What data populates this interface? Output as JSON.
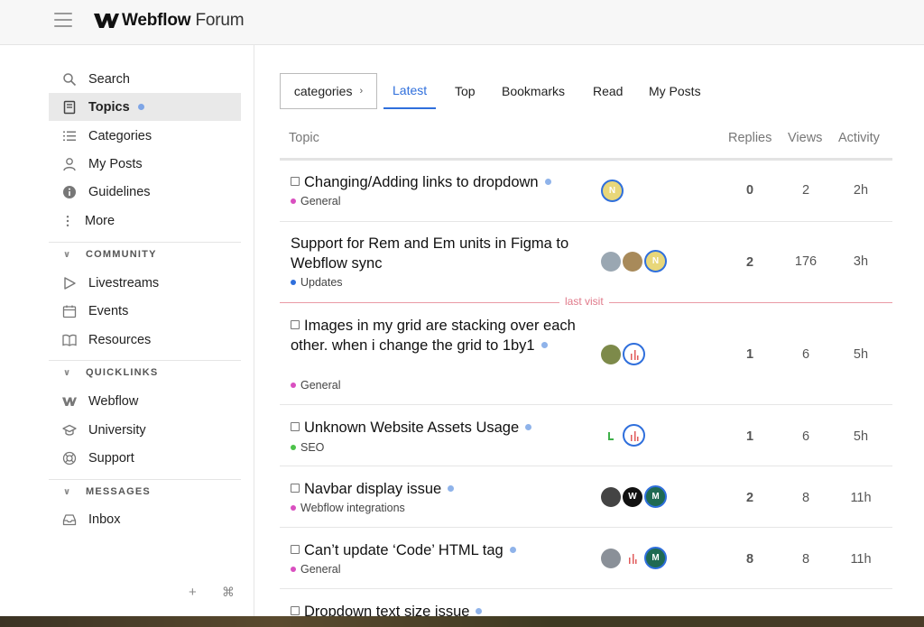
{
  "header": {
    "brand_bold": "Webflow",
    "brand_light": "Forum"
  },
  "sidebar": {
    "items": [
      {
        "label": "Search",
        "icon": "search-icon"
      },
      {
        "label": "Topics",
        "icon": "topics-icon",
        "active": true
      },
      {
        "label": "Categories",
        "icon": "categories-icon"
      },
      {
        "label": "My Posts",
        "icon": "user-icon"
      },
      {
        "label": "Guidelines",
        "icon": "info-icon"
      },
      {
        "label": "More",
        "icon": "more-icon"
      }
    ],
    "community": {
      "title": "COMMUNITY",
      "items": [
        "Livestreams",
        "Events",
        "Resources"
      ]
    },
    "quicklinks": {
      "title": "QUICKLINKS",
      "items": [
        "Webflow",
        "University",
        "Support"
      ]
    },
    "messages": {
      "title": "MESSAGES",
      "items": [
        "Inbox"
      ]
    },
    "footer": {
      "add": "+",
      "shortcut": "⌘"
    }
  },
  "nav": {
    "categories_btn": "categories",
    "categories_arrow": "›",
    "tabs": [
      "Latest",
      "Top",
      "Bookmarks",
      "Read",
      "My Posts"
    ]
  },
  "table": {
    "headers": {
      "topic": "Topic",
      "replies": "Replies",
      "views": "Views",
      "activity": "Activity"
    },
    "last_visit": "last visit",
    "rows": [
      {
        "title": "Changing/Adding links to dropdown",
        "category": "General",
        "cat_color": "#d94fc0",
        "replies": "0",
        "views": "2",
        "activity": "2h",
        "posters": [
          "N"
        ]
      },
      {
        "title": "Support for Rem and Em units in Figma to Webflow sync",
        "category": "Updates",
        "cat_color": "#2f6fdc",
        "replies": "2",
        "views": "176",
        "activity": "3h",
        "posters": [
          "",
          "",
          "N"
        ]
      },
      {
        "title": "Images in my grid are stacking over each other. when i change the grid to 1by1",
        "category": "General",
        "cat_color": "#d94fc0",
        "replies": "1",
        "views": "6",
        "activity": "5h",
        "posters": [
          "",
          ""
        ]
      },
      {
        "title": "Unknown Website Assets Usage",
        "category": "SEO",
        "cat_color": "#4cc24a",
        "replies": "1",
        "views": "6",
        "activity": "5h",
        "posters": [
          "",
          ""
        ]
      },
      {
        "title": "Navbar display issue",
        "category": "Webflow integrations",
        "cat_color": "#d94fc0",
        "replies": "2",
        "views": "8",
        "activity": "11h",
        "posters": [
          "",
          "W",
          "M"
        ]
      },
      {
        "title": "Can’t update ‘Code’ HTML tag",
        "category": "General",
        "cat_color": "#d94fc0",
        "replies": "8",
        "views": "8",
        "activity": "11h",
        "posters": [
          "",
          "",
          "M"
        ]
      },
      {
        "title": "Dropdown text size issue",
        "category": "",
        "cat_color": "#d94fc0",
        "replies": "",
        "views": "",
        "activity": "",
        "posters": []
      }
    ]
  },
  "colors": {
    "accent": "#2f6fdc",
    "last_visit": "#e07a8a",
    "unread_dot": "#8fb3ea"
  }
}
